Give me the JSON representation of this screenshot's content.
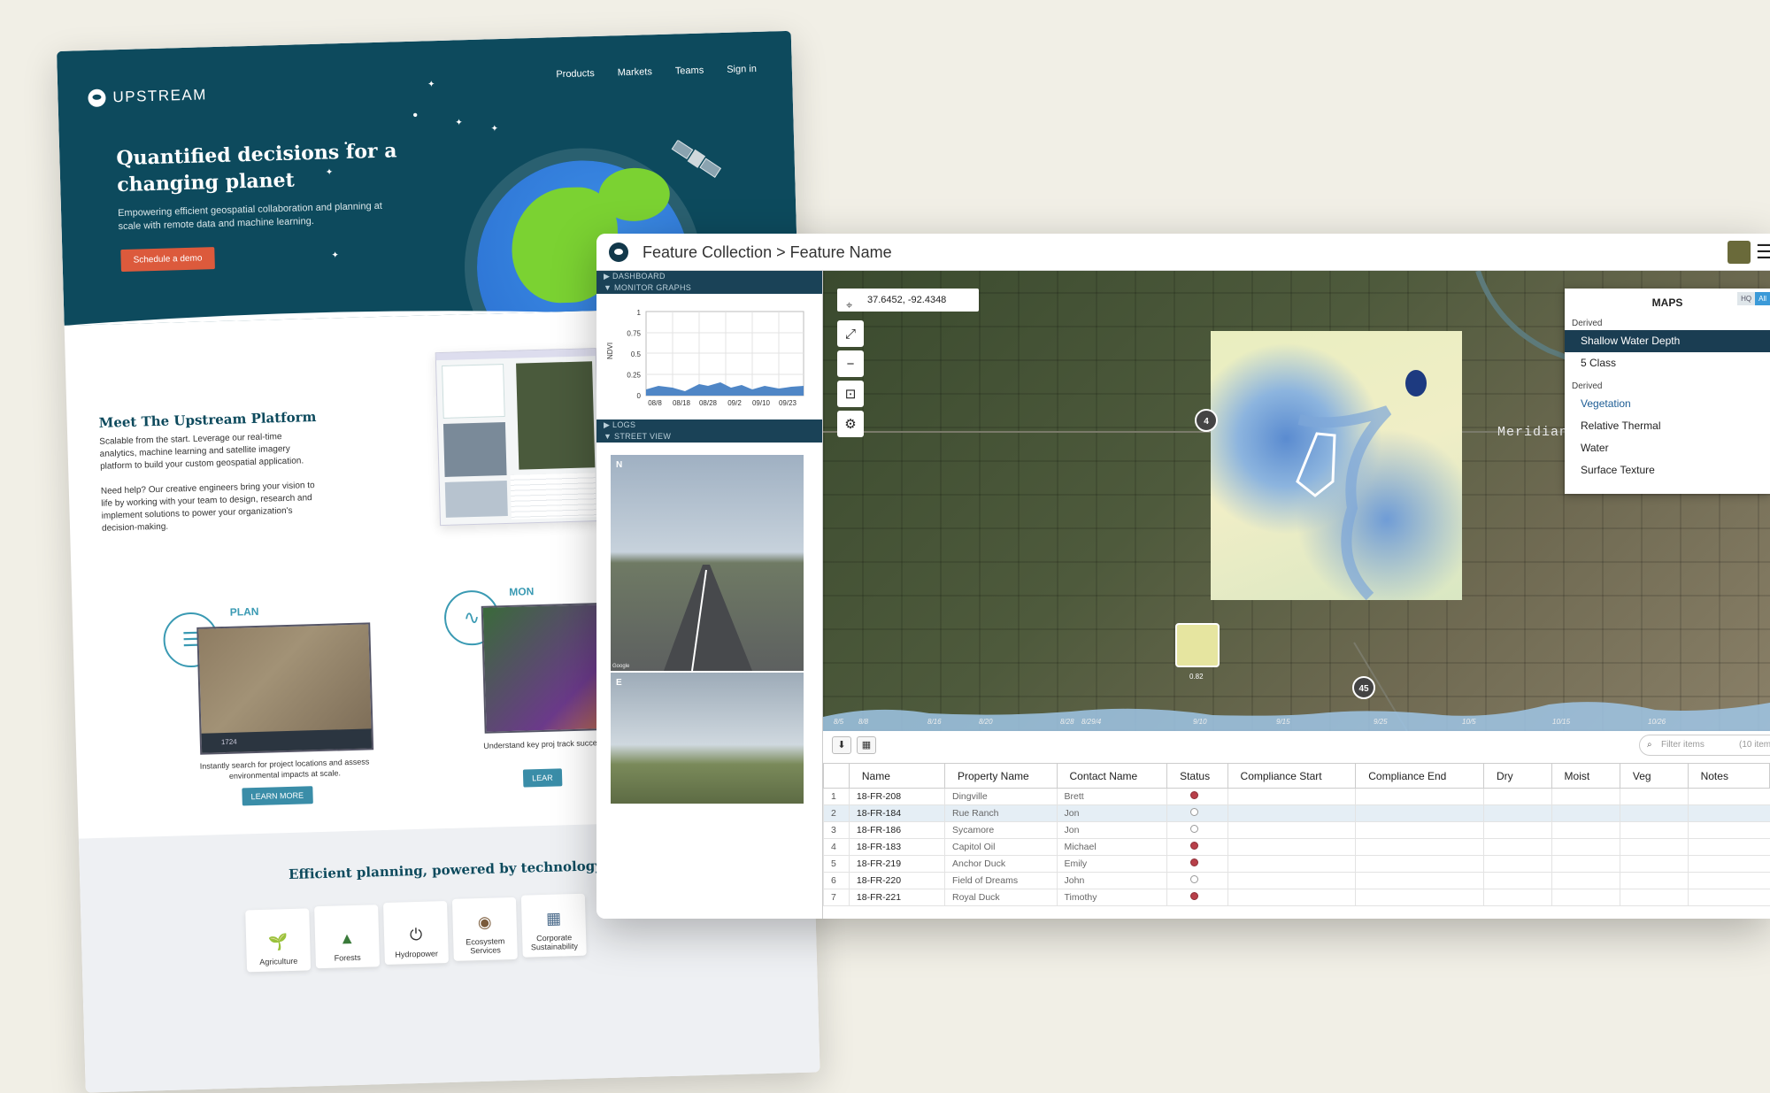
{
  "marketing": {
    "brand": "UPSTREAM",
    "nav": [
      "Products",
      "Markets",
      "Teams",
      "Sign in"
    ],
    "hero_title": "Quantified decisions for a changing planet",
    "hero_subtitle": "Empowering efficient geospatial collaboration and planning at scale with remote data and machine learning.",
    "cta_label": "Schedule a demo",
    "platform_title": "Meet The Upstream Platform",
    "platform_p1": "Scalable from the start. Leverage our real-time analytics, machine learning and satellite imagery platform to build your custom geospatial application.",
    "platform_p2": "Need help? Our creative engineers bring your vision to life by working with your team to design, research and implement solutions to power your organization's decision-making.",
    "plan_label": "PLAN",
    "plan_caption": "Instantly search for project locations and assess environmental impacts at scale.",
    "plan_count": "1724",
    "monitor_label": "MON",
    "monitor_caption": "Understand key proj track successes an",
    "learn_more": "LEARN MORE",
    "learn_more_partial": "LEAR",
    "efficient_title": "Efficient planning, powered by technology.",
    "categories": [
      "Agriculture",
      "Forests",
      "Hydropower",
      "Ecosystem Services",
      "Corporate Sustainability"
    ]
  },
  "app": {
    "breadcrumb": "Feature Collection > Feature Name",
    "panes": {
      "dashboard": "DASHBOARD",
      "monitor_graphs": "MONITOR GRAPHS",
      "logs": "LOGS",
      "street_view": "STREET VIEW"
    },
    "graph": {
      "ylabel": "NDVI",
      "yticks": [
        "1",
        "0.75",
        "0.5",
        "0.25",
        "0"
      ],
      "xticks": [
        "08/8",
        "08/18",
        "08/28",
        "09/2",
        "09/10",
        "09/23"
      ]
    },
    "street_view_labels": [
      "N",
      "E"
    ],
    "street_view_credit": "Google",
    "coordinates": "37.6452, -92.4348",
    "place_label": "Meridian",
    "maps_panel": {
      "title": "MAPS",
      "toggle": [
        "HQ",
        "All"
      ],
      "groups": [
        {
          "label": "Derived",
          "items": [
            "Shallow Water Depth",
            "5 Class"
          ]
        },
        {
          "label": "Derived",
          "items": [
            "Vegetation",
            "Relative Thermal",
            "Water",
            "Surface Texture"
          ]
        }
      ]
    },
    "markers": [
      "4",
      "45"
    ],
    "thumb_value": "0.82",
    "timeline_labels": [
      "8/5",
      "8/8",
      "8/16",
      "8/20",
      "8/28",
      "8/29/4",
      "9/10",
      "9/15",
      "9/25",
      "10/5",
      "10/15",
      "10/26"
    ],
    "filter_placeholder": "Filter items",
    "filter_count": "(10 items)",
    "table": {
      "columns": [
        "Name",
        "Property Name",
        "Contact Name",
        "Status",
        "Compliance Start",
        "Compliance End",
        "Dry",
        "Moist",
        "Veg",
        "Notes"
      ],
      "rows": [
        {
          "n": "1",
          "name": "18-FR-208",
          "property": "Dingville",
          "contact": "Brett",
          "status": "red"
        },
        {
          "n": "2",
          "name": "18-FR-184",
          "property": "Rue Ranch",
          "contact": "Jon",
          "status": "empty"
        },
        {
          "n": "3",
          "name": "18-FR-186",
          "property": "Sycamore",
          "contact": "Jon",
          "status": "empty"
        },
        {
          "n": "4",
          "name": "18-FR-183",
          "property": "Capitol Oil",
          "contact": "Michael",
          "status": "red"
        },
        {
          "n": "5",
          "name": "18-FR-219",
          "property": "Anchor Duck",
          "contact": "Emily",
          "status": "red"
        },
        {
          "n": "6",
          "name": "18-FR-220",
          "property": "Field of Dreams",
          "contact": "John",
          "status": "empty"
        },
        {
          "n": "7",
          "name": "18-FR-221",
          "property": "Royal Duck",
          "contact": "Timothy",
          "status": "red"
        }
      ]
    }
  },
  "colors": {
    "hero_bg": "#0d4a5d",
    "cta": "#dc5a3c",
    "accent_teal": "#3a9ab3",
    "app_dark": "#1a3d52",
    "status_red": "#b8404a"
  }
}
